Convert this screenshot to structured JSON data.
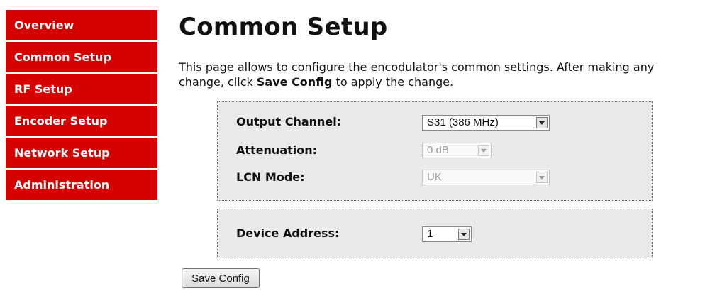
{
  "sidebar": {
    "items": [
      {
        "label": "Overview"
      },
      {
        "label": "Common Setup"
      },
      {
        "label": "RF Setup"
      },
      {
        "label": "Encoder Setup"
      },
      {
        "label": "Network Setup"
      },
      {
        "label": "Administration"
      }
    ]
  },
  "main": {
    "title": "Common Setup",
    "intro_before": "This page allows to configure the encodulator's common settings. After making any change, click ",
    "intro_bold": "Save Config",
    "intro_after": " to apply the change."
  },
  "panel1": {
    "output_channel": {
      "label": "Output Channel:",
      "value": "S31 (386 MHz)"
    },
    "attenuation": {
      "label": "Attenuation:",
      "value": "0 dB"
    },
    "lcn_mode": {
      "label": "LCN Mode:",
      "value": "UK"
    }
  },
  "panel2": {
    "device_address": {
      "label": "Device Address:",
      "value": "1"
    }
  },
  "save_button": {
    "label": "Save Config"
  },
  "colors": {
    "nav_bg": "#d50000",
    "panel_bg": "#eaeaea"
  }
}
